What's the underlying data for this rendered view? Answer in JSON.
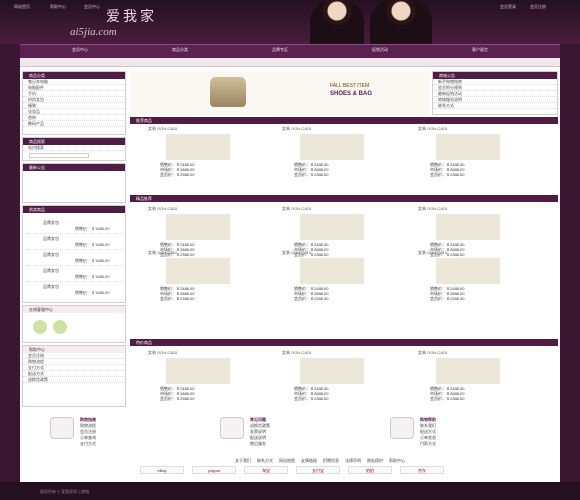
{
  "header": {
    "site_name_cn": "爱我家",
    "site_name_en": "ai5jia.com",
    "top_links": [
      "网站首页",
      "帮助中心",
      "会员中心"
    ],
    "right_links": [
      "会员登录",
      "会员注册"
    ]
  },
  "nav": {
    "items": [
      "会员中心",
      "商品分类",
      "品牌专区",
      "促销活动",
      "客户留言"
    ]
  },
  "sidebar": {
    "category_title": "商品分类",
    "categories": [
      "笔记本电脑",
      "电脑配件",
      "手机",
      "时尚女包",
      "服装",
      "化妆品",
      "首饰",
      "数码产品",
      "时尚精品",
      "男装"
    ],
    "search_title": "商品搜索",
    "search_label": "站内搜索",
    "announce_title": "最新公告",
    "hot_title": "热卖商品",
    "hot_items": [
      "品牌女包",
      "品牌女包",
      "品牌女包",
      "品牌女包",
      "品牌女包"
    ],
    "hot_price_label": "销售价：￥1588.00",
    "service_title": "在线客服中心",
    "help_title": "帮助中心",
    "help_items": [
      "会员注册",
      "购物流程",
      "支付方式",
      "配送方式",
      "退换货政策"
    ]
  },
  "main": {
    "banner_text_1": "FALL BEST ITEM",
    "banner_text_2": "SHOES & BAG",
    "news_title": "商城公告",
    "news_items": [
      "新手购物指南",
      "会员积分规则",
      "最新促销活动",
      "商城服务说明",
      "联系方式"
    ],
    "sections": [
      "推荐商品",
      "精品推荐",
      "特价商品"
    ],
    "product_name": "女装 OGH-C810",
    "price_sale": "销售价：￥2488.00",
    "price_market": "市场价：￥2888.00",
    "price_vip": "会员价：￥2388.00"
  },
  "footer": {
    "col1_title": "购物指南",
    "col1_items": [
      "购物流程",
      "会员注册",
      "订单查询",
      "支付方式"
    ],
    "col2_title": "常见问题",
    "col2_items": [
      "退换货政策",
      "发票说明",
      "配送说明",
      "售后服务"
    ],
    "col3_title": "购物帮助",
    "col3_items": [
      "联系我们",
      "配送方式",
      "订单状态",
      "付款方式"
    ],
    "links": [
      "关于我们",
      "联系方式",
      "网站地图",
      "友情链接",
      "招聘信息",
      "法律声明",
      "隐私保护",
      "帮助中心"
    ],
    "partner_logos": [
      "eBay",
      "paypal",
      "淘宝",
      "支付宝",
      "拍拍",
      "京东"
    ],
    "copyright": "版权所有 © 爱我家网上商城"
  }
}
